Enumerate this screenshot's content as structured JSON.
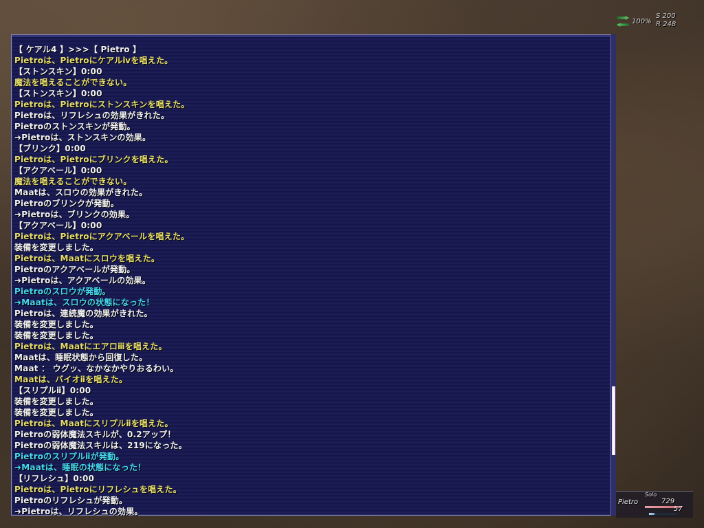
{
  "status": {
    "compass_percent": "100%",
    "s_value": "S 200",
    "r_value": "R 248"
  },
  "chat": {
    "lines": [
      {
        "text": "【 ケアル4 】>>>【 Pietro 】",
        "color": "white"
      },
      {
        "text": "Pietroは、Pietroにケアルⅳを唱えた。",
        "color": "yellow"
      },
      {
        "text": "【ストンスキン】0:00",
        "color": "white"
      },
      {
        "text": "魔法を唱えることができない。",
        "color": "yellow"
      },
      {
        "text": "【ストンスキン】0:00",
        "color": "white"
      },
      {
        "text": "Pietroは、Pietroにストンスキンを唱えた。",
        "color": "yellow"
      },
      {
        "text": "Pietroは、リフレシュの効果がきれた。",
        "color": "white"
      },
      {
        "text": "Pietroのストンスキンが発動。",
        "color": "white"
      },
      {
        "text": "➜Pietroは、ストンスキンの効果。",
        "color": "white"
      },
      {
        "text": "【ブリンク】0:00",
        "color": "white"
      },
      {
        "text": "Pietroは、Pietroにブリンクを唱えた。",
        "color": "yellow"
      },
      {
        "text": "【アクアベール】0:00",
        "color": "white"
      },
      {
        "text": "魔法を唱えることができない。",
        "color": "yellow"
      },
      {
        "text": "Maatは、スロウの効果がきれた。",
        "color": "white"
      },
      {
        "text": "Pietroのブリンクが発動。",
        "color": "white"
      },
      {
        "text": "➜Pietroは、ブリンクの効果。",
        "color": "white"
      },
      {
        "text": "【アクアベール】0:00",
        "color": "white"
      },
      {
        "text": "Pietroは、Pietroにアクアベールを唱えた。",
        "color": "yellow"
      },
      {
        "text": "装備を変更しました。",
        "color": "white"
      },
      {
        "text": "Pietroは、Maatにスロウを唱えた。",
        "color": "yellow"
      },
      {
        "text": "Pietroのアクアベールが発動。",
        "color": "white"
      },
      {
        "text": "➜Pietroは、アクアベールの効果。",
        "color": "white"
      },
      {
        "text": "Pietroのスロウが発動。",
        "color": "cyan"
      },
      {
        "text": "➜Maatは、スロウの状態になった！",
        "color": "cyan"
      },
      {
        "text": "Pietroは、連続魔の効果がきれた。",
        "color": "white"
      },
      {
        "text": "装備を変更しました。",
        "color": "white"
      },
      {
        "text": "装備を変更しました。",
        "color": "white"
      },
      {
        "text": "Pietroは、Maatにエアロⅲを唱えた。",
        "color": "yellow"
      },
      {
        "text": "Maatは、睡眠状態から回復した。",
        "color": "white"
      },
      {
        "text": "Maat ： ウグッ、なかなかやりおるわい。",
        "color": "white"
      },
      {
        "text": "Maatは、バイオⅱを唱えた。",
        "color": "yellow"
      },
      {
        "text": "【スリプルⅱ】0:00",
        "color": "white"
      },
      {
        "text": "装備を変更しました。",
        "color": "white"
      },
      {
        "text": "装備を変更しました。",
        "color": "white"
      },
      {
        "text": "Pietroは、Maatにスリプルⅱを唱えた。",
        "color": "yellow"
      },
      {
        "text": "Pietroの弱体魔法スキルが、0.2アップ！",
        "color": "white"
      },
      {
        "text": "Pietroの弱体魔法スキルは、219になった。",
        "color": "white"
      },
      {
        "text": "Pietroのスリプルⅱが発動。",
        "color": "cyan"
      },
      {
        "text": "➜Maatは、睡眠の状態になった！",
        "color": "cyan"
      },
      {
        "text": "【リフレシュ】0:00",
        "color": "white"
      },
      {
        "text": "Pietroは、Pietroにリフレシュを唱えた。",
        "color": "yellow"
      },
      {
        "text": "Pietroのリフレシュが発動。",
        "color": "white"
      },
      {
        "text": "➜Pietroは、リフレシュの効果。",
        "color": "white"
      }
    ]
  },
  "party": {
    "tag": "Solo",
    "member_name": "Pietro",
    "hp": "729",
    "mp": "57",
    "hp_fraction": 0.95,
    "mp_fraction": 0.2
  },
  "colors": {
    "white": "#f2f2f2",
    "yellow": "#e8de6a",
    "cyan": "#45d9f0"
  }
}
